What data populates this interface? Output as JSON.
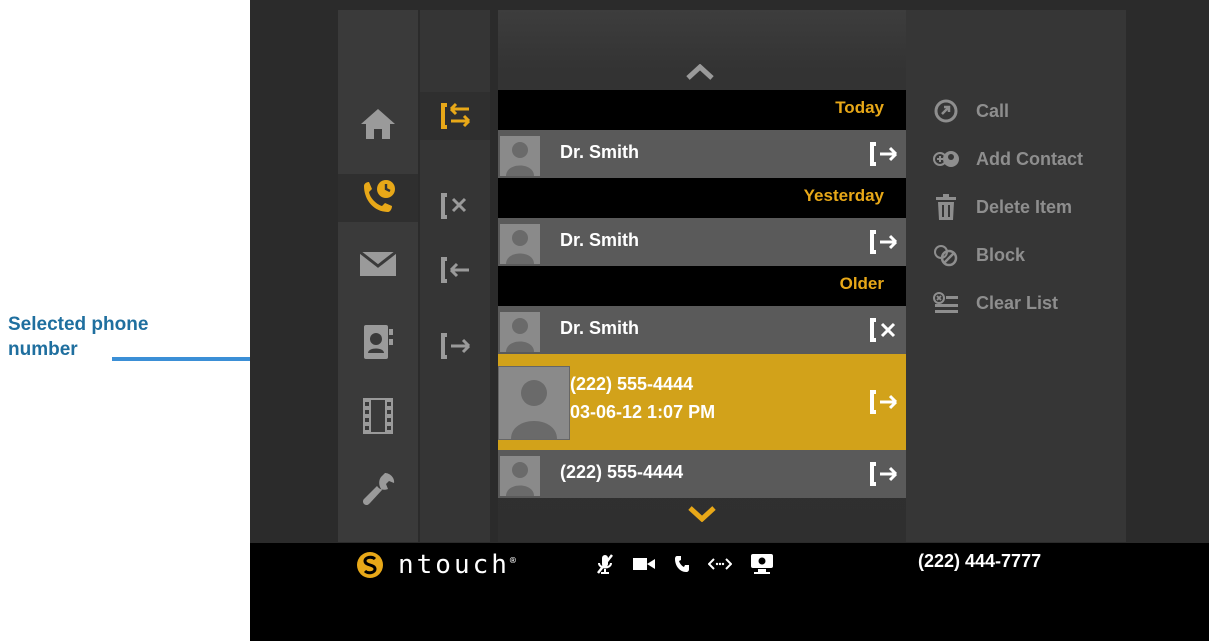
{
  "annotation": {
    "line1": "Selected phone",
    "line2": "number"
  },
  "nav": {
    "items": [
      "home-icon",
      "call-history-icon",
      "messages-icon",
      "contacts-icon",
      "video-icon",
      "settings-icon"
    ]
  },
  "filters": {
    "items": [
      "all-calls-icon",
      "missed-calls-icon",
      "incoming-calls-icon",
      "outgoing-calls-icon"
    ]
  },
  "list": {
    "groups": [
      {
        "header": "Today",
        "rows": [
          {
            "name": "Dr. Smith",
            "direction": "outgoing"
          }
        ]
      },
      {
        "header": "Yesterday",
        "rows": [
          {
            "name": "Dr. Smith",
            "direction": "outgoing"
          }
        ]
      },
      {
        "header": "Older",
        "rows": [
          {
            "name": "Dr. Smith",
            "direction": "missed"
          },
          {
            "name": "(222) 555-4444",
            "detail": "03-06-12  1:07 PM",
            "direction": "outgoing",
            "selected": true
          },
          {
            "name": "(222) 555-4444",
            "direction": "outgoing"
          }
        ]
      }
    ]
  },
  "actions": {
    "call": "Call",
    "add_contact": "Add Contact",
    "delete_item": "Delete Item",
    "block": "Block",
    "clear_list": "Clear List"
  },
  "footer": {
    "brand": "ntouch",
    "trademark": "®",
    "phone": "(222) 444-7777"
  },
  "colors": {
    "accent": "#e8a818",
    "selected_row": "#d2a21a",
    "annotation": "#1f6f9f",
    "arrow": "#3b8fd6"
  }
}
